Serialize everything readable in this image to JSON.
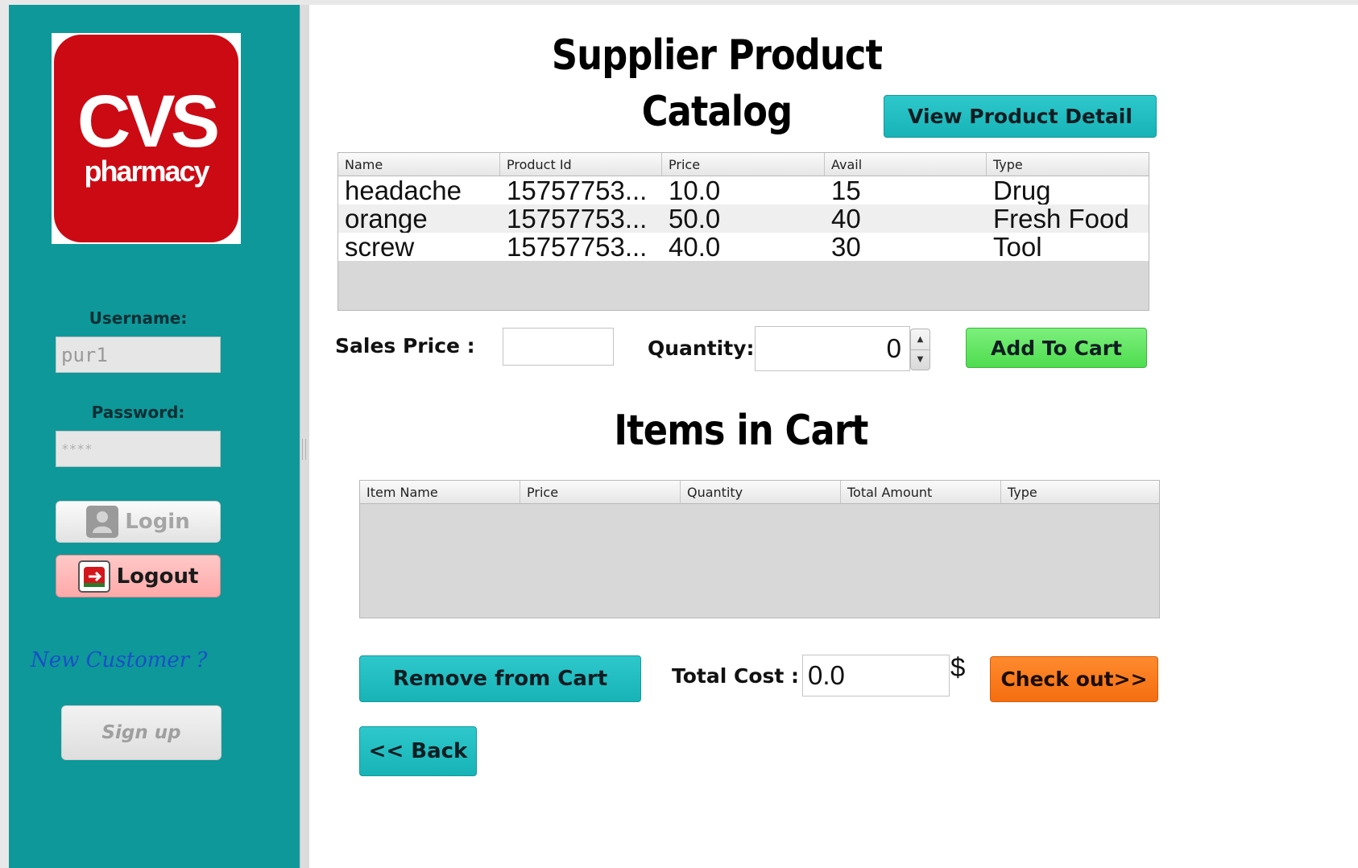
{
  "sidebar": {
    "logo": {
      "brand": "CVS",
      "sub": "pharmacy"
    },
    "username": {
      "label": "Username:",
      "value": "pur1"
    },
    "password": {
      "label": "Password:",
      "value": "****"
    },
    "login_label": "Login",
    "logout_label": "Logout",
    "new_customer": "New Customer ?",
    "signup_label": "Sign up"
  },
  "main": {
    "catalog_title": "Supplier Product Catalog",
    "view_detail_label": "View Product Detail",
    "catalog_table": {
      "columns": [
        "Name",
        "Product Id",
        "Price",
        "Avail",
        "Type"
      ],
      "rows": [
        [
          "headache",
          "15757753...",
          "10.0",
          "15",
          "Drug"
        ],
        [
          "orange",
          "15757753...",
          "50.0",
          "40",
          "Fresh Food"
        ],
        [
          "screw",
          "15757753...",
          "40.0",
          "30",
          "Tool"
        ]
      ]
    },
    "sales_price": {
      "label": "Sales Price :",
      "value": ""
    },
    "quantity": {
      "label": "Quantity:",
      "value": "0"
    },
    "add_to_cart_label": "Add To Cart",
    "cart_title": "Items in Cart",
    "cart_table": {
      "columns": [
        "Item Name",
        "Price",
        "Quantity",
        "Total Amount",
        "Type"
      ],
      "rows": []
    },
    "remove_label": "Remove from Cart",
    "total_cost": {
      "label": "Total Cost :",
      "value": "0.0",
      "currency": "$"
    },
    "checkout_label": "Check out>>",
    "back_label": "<< Back"
  },
  "colors": {
    "sidebar": "#0e989a",
    "teal_button": "#1fbcc0",
    "add_to_cart": "#5fe65f",
    "checkout": "#f47a1c",
    "logout": "#ffb4b4",
    "cvs_red": "#cc0a14"
  },
  "icons": {
    "login": "login-person-icon",
    "logout": "logout-exit-icon"
  }
}
